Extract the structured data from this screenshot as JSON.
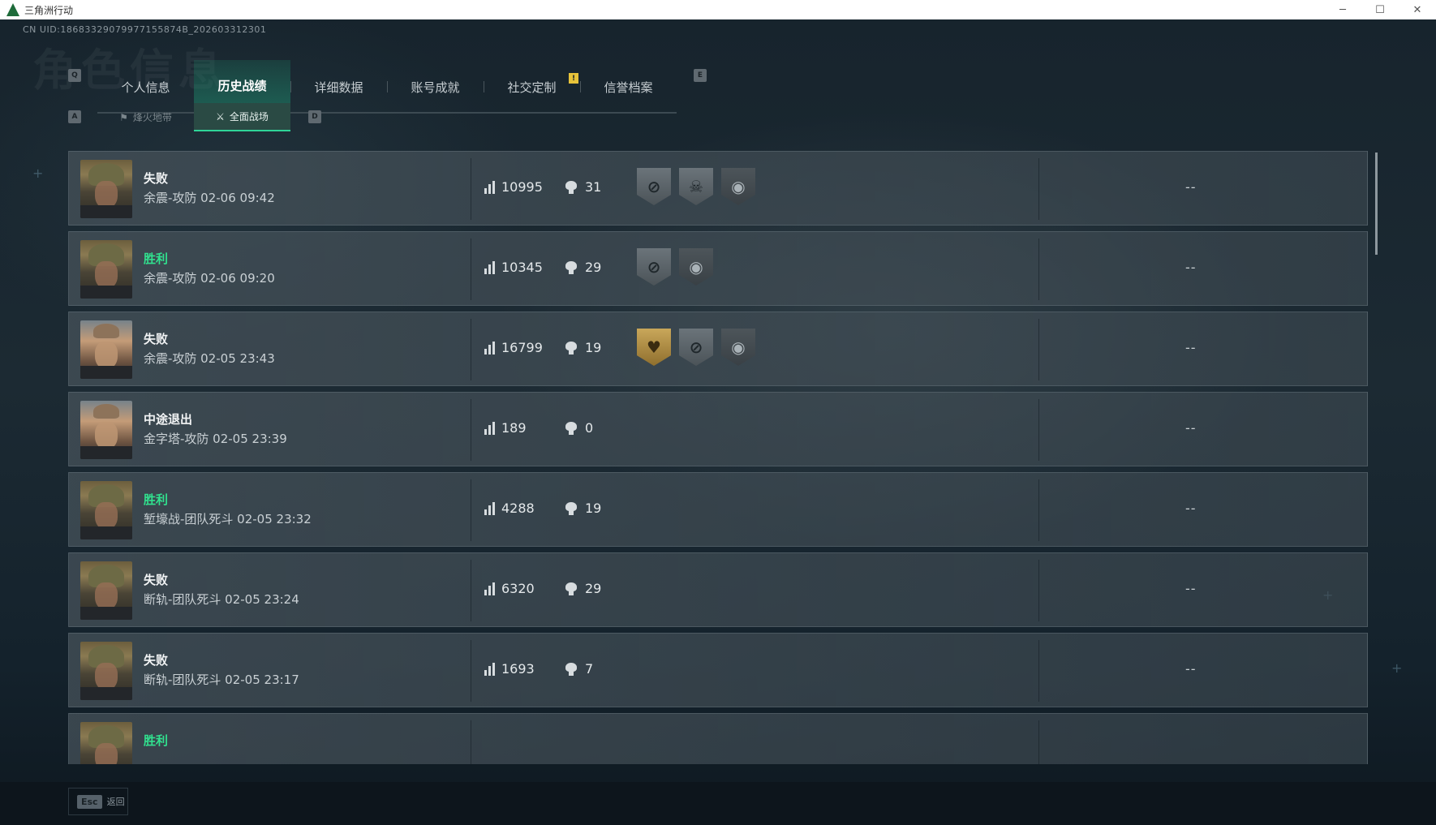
{
  "window": {
    "title": "三角洲行动",
    "controls": [
      "─",
      "☐",
      "✕"
    ]
  },
  "header": {
    "uid": "CN UID:18683329079977155874B_202603312301",
    "bg_title": "角色信息"
  },
  "tabs": {
    "prev_key": "Q",
    "next_key": "E",
    "items": [
      {
        "label": "个人信息",
        "active": false
      },
      {
        "label": "历史战绩",
        "active": true
      },
      {
        "label": "详细数据",
        "active": false
      },
      {
        "label": "账号成就",
        "active": false
      },
      {
        "label": "社交定制",
        "active": false,
        "notice": "!"
      },
      {
        "label": "信誉档案",
        "active": false
      }
    ]
  },
  "subtabs": {
    "prev_key": "A",
    "next_key": "D",
    "items": [
      {
        "label": "烽火地带",
        "icon": "fire-zone-icon",
        "glyph": "⚑",
        "active": false
      },
      {
        "label": "全面战场",
        "icon": "battlefield-icon",
        "glyph": "⚔",
        "active": true
      }
    ]
  },
  "matches": [
    {
      "result": "失败",
      "win": false,
      "meta": "余震-攻防 02-06 09:42",
      "score": "10995",
      "kills": "31",
      "avatar": "heavy",
      "medals": [
        {
          "glyph": "⊘",
          "style": "silver"
        },
        {
          "glyph": "☠",
          "style": "silver"
        },
        {
          "glyph": "◉",
          "style": "dark"
        }
      ],
      "extra": "--"
    },
    {
      "result": "胜利",
      "win": true,
      "meta": "余震-攻防 02-06 09:20",
      "score": "10345",
      "kills": "29",
      "avatar": "heavy",
      "medals": [
        {
          "glyph": "⊘",
          "style": "silver"
        },
        {
          "glyph": "◉",
          "style": "dark"
        }
      ],
      "extra": "--"
    },
    {
      "result": "失败",
      "win": false,
      "meta": "余震-攻防 02-05 23:43",
      "score": "16799",
      "kills": "19",
      "avatar": "light",
      "medals": [
        {
          "glyph": "♥",
          "style": "gold"
        },
        {
          "glyph": "⊘",
          "style": "silver"
        },
        {
          "glyph": "◉",
          "style": "dark"
        }
      ],
      "extra": "--"
    },
    {
      "result": "中途退出",
      "win": false,
      "meta": "金字塔-攻防 02-05 23:39",
      "score": "189",
      "kills": "0",
      "avatar": "light",
      "medals": [],
      "extra": "--"
    },
    {
      "result": "胜利",
      "win": true,
      "meta": "堑壕战-团队死斗 02-05 23:32",
      "score": "4288",
      "kills": "19",
      "avatar": "heavy",
      "medals": [],
      "extra": "--"
    },
    {
      "result": "失败",
      "win": false,
      "meta": "断轨-团队死斗 02-05 23:24",
      "score": "6320",
      "kills": "29",
      "avatar": "heavy",
      "medals": [],
      "extra": "--"
    },
    {
      "result": "失败",
      "win": false,
      "meta": "断轨-团队死斗 02-05 23:17",
      "score": "1693",
      "kills": "7",
      "avatar": "heavy",
      "medals": [],
      "extra": "--"
    },
    {
      "result": "胜利",
      "win": true,
      "meta": "",
      "score": "",
      "kills": "",
      "avatar": "heavy",
      "medals": [],
      "extra": ""
    }
  ],
  "footer": {
    "esc_key": "Esc",
    "esc_label": "返回"
  },
  "colors": {
    "accent": "#2fd598",
    "win": "#31e08e",
    "notice": "#e7c33a"
  }
}
